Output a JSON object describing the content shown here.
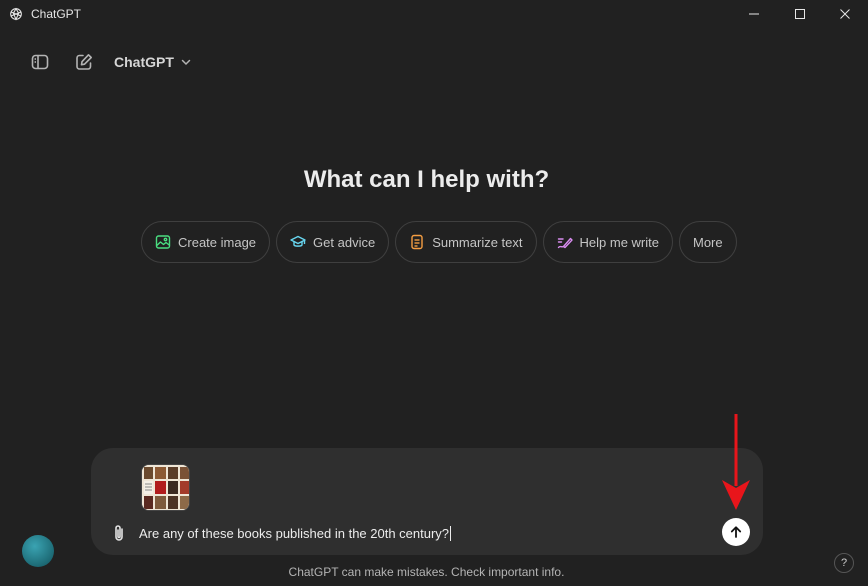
{
  "window": {
    "title": "ChatGPT"
  },
  "toolbar": {
    "model_label": "ChatGPT"
  },
  "main": {
    "heading": "What can I help with?"
  },
  "suggestions": [
    {
      "label": "Create image",
      "icon": "image-icon",
      "color": "#4ade80"
    },
    {
      "label": "Get advice",
      "icon": "graduation-cap-icon",
      "color": "#67d6f0"
    },
    {
      "label": "Summarize text",
      "icon": "document-icon",
      "color": "#f59e42"
    },
    {
      "label": "Help me write",
      "icon": "pen-icon",
      "color": "#d98cf0"
    },
    {
      "label": "More",
      "icon": "",
      "color": ""
    }
  ],
  "composer": {
    "attachment": "books-thumbnail",
    "input_value": "Are any of these books published in the 20th century?"
  },
  "footer": {
    "disclaimer": "ChatGPT can make mistakes. Check important info.",
    "help_label": "?"
  },
  "annotation": {
    "color": "#e8151b"
  }
}
